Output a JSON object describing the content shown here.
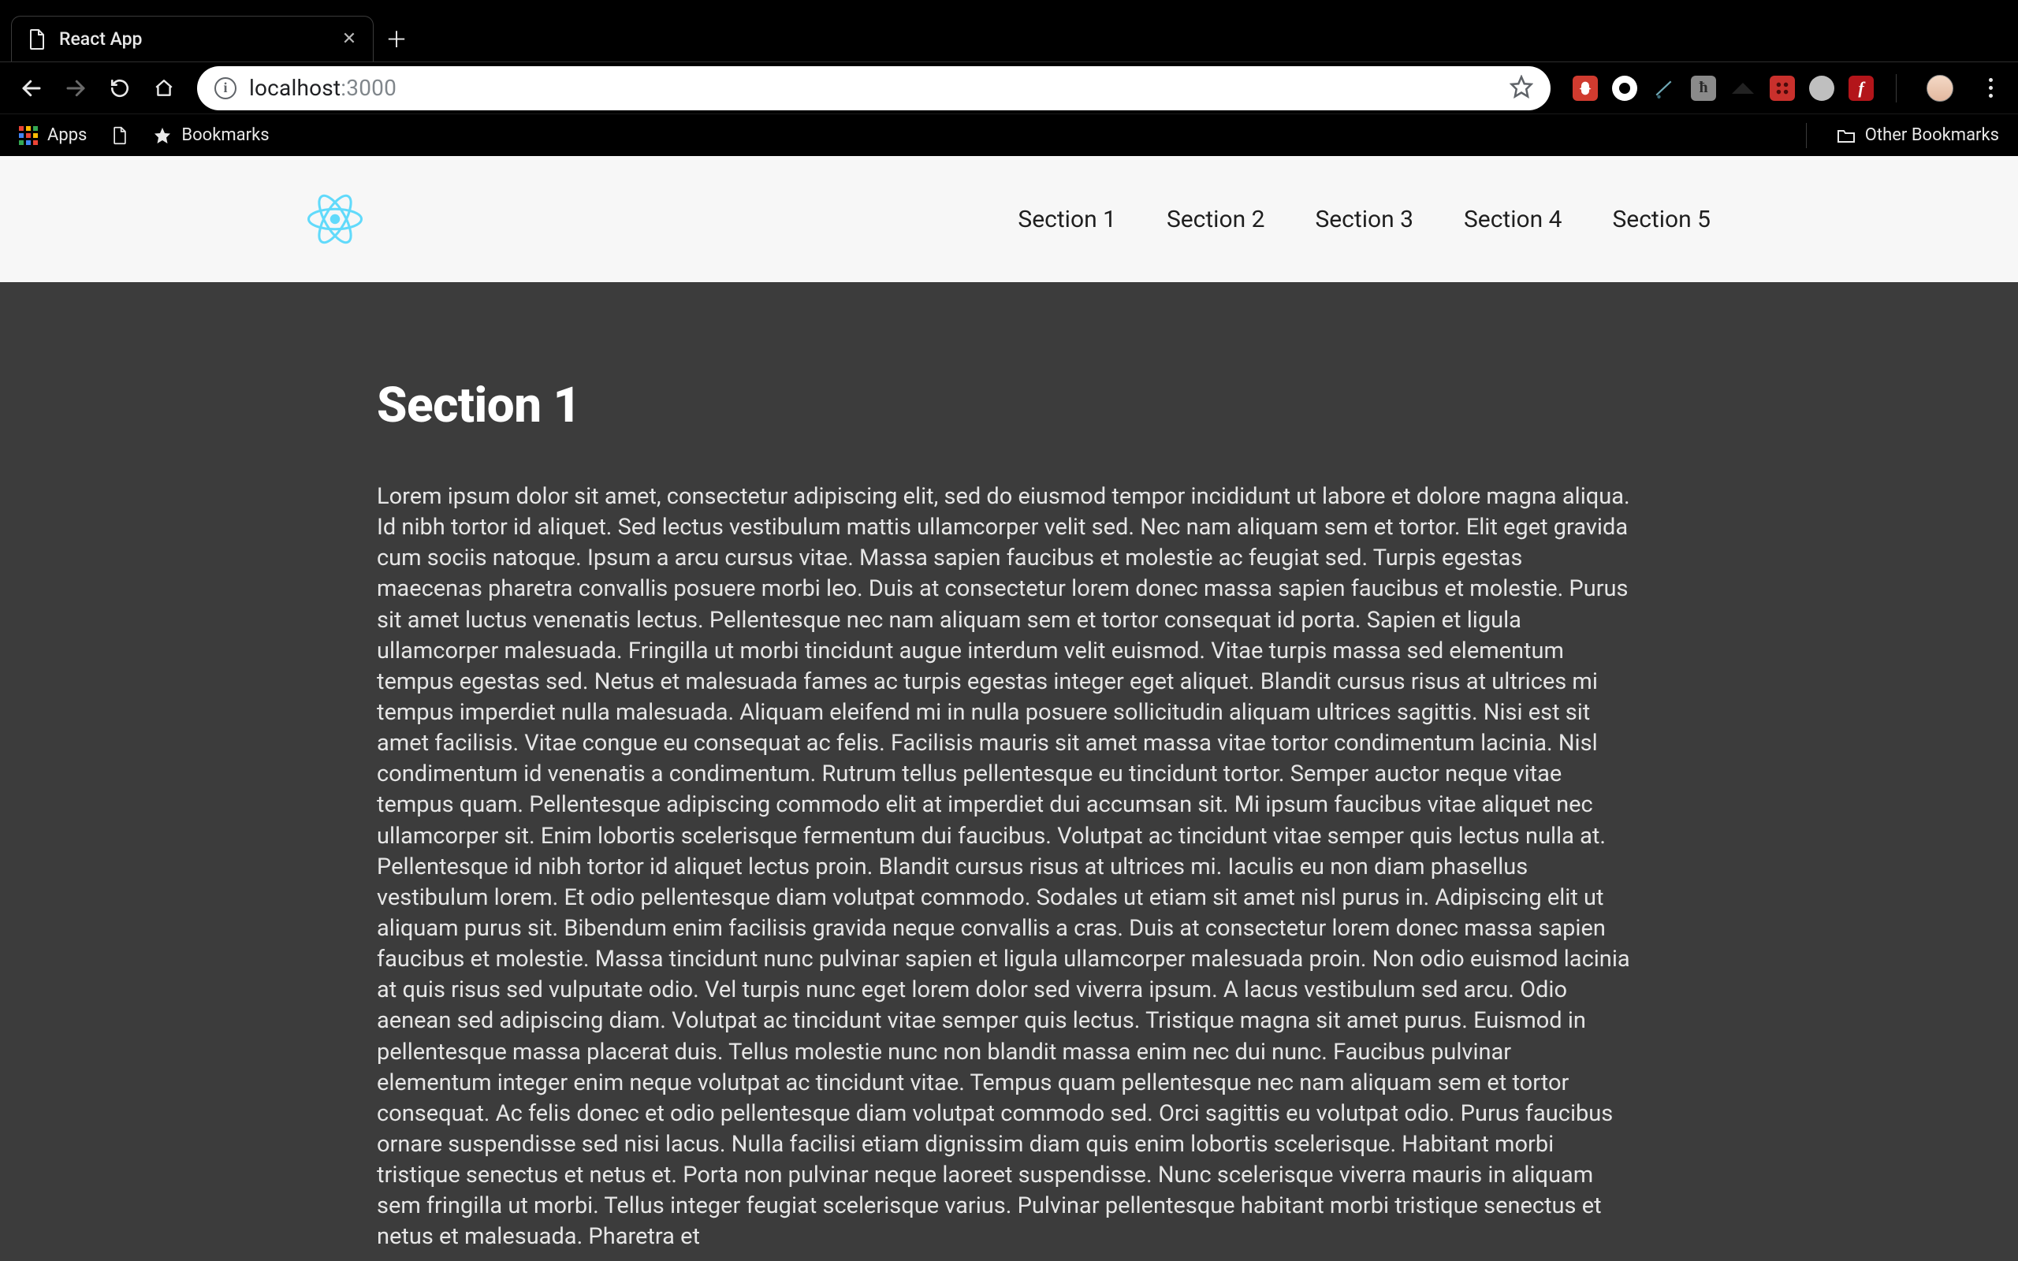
{
  "browser": {
    "tab_title": "React App",
    "url_host": "localhost",
    "url_port": ":3000",
    "bookmarks_bar": {
      "apps": "Apps",
      "bookmarks": "Bookmarks",
      "other": "Other Bookmarks"
    }
  },
  "page": {
    "nav": [
      "Section 1",
      "Section 2",
      "Section 3",
      "Section 4",
      "Section 5"
    ],
    "heading": "Section 1",
    "body": "Lorem ipsum dolor sit amet, consectetur adipiscing elit, sed do eiusmod tempor incididunt ut labore et dolore magna aliqua. Id nibh tortor id aliquet. Sed lectus vestibulum mattis ullamcorper velit sed. Nec nam aliquam sem et tortor. Elit eget gravida cum sociis natoque. Ipsum a arcu cursus vitae. Massa sapien faucibus et molestie ac feugiat sed. Turpis egestas maecenas pharetra convallis posuere morbi leo. Duis at consectetur lorem donec massa sapien faucibus et molestie. Purus sit amet luctus venenatis lectus. Pellentesque nec nam aliquam sem et tortor consequat id porta. Sapien et ligula ullamcorper malesuada. Fringilla ut morbi tincidunt augue interdum velit euismod. Vitae turpis massa sed elementum tempus egestas sed. Netus et malesuada fames ac turpis egestas integer eget aliquet. Blandit cursus risus at ultrices mi tempus imperdiet nulla malesuada. Aliquam eleifend mi in nulla posuere sollicitudin aliquam ultrices sagittis. Nisi est sit amet facilisis. Vitae congue eu consequat ac felis. Facilisis mauris sit amet massa vitae tortor condimentum lacinia. Nisl condimentum id venenatis a condimentum. Rutrum tellus pellentesque eu tincidunt tortor. Semper auctor neque vitae tempus quam. Pellentesque adipiscing commodo elit at imperdiet dui accumsan sit. Mi ipsum faucibus vitae aliquet nec ullamcorper sit. Enim lobortis scelerisque fermentum dui faucibus. Volutpat ac tincidunt vitae semper quis lectus nulla at. Pellentesque id nibh tortor id aliquet lectus proin. Blandit cursus risus at ultrices mi. Iaculis eu non diam phasellus vestibulum lorem. Et odio pellentesque diam volutpat commodo. Sodales ut etiam sit amet nisl purus in. Adipiscing elit ut aliquam purus sit. Bibendum enim facilisis gravida neque convallis a cras. Duis at consectetur lorem donec massa sapien faucibus et molestie. Massa tincidunt nunc pulvinar sapien et ligula ullamcorper malesuada proin. Non odio euismod lacinia at quis risus sed vulputate odio. Vel turpis nunc eget lorem dolor sed viverra ipsum. A lacus vestibulum sed arcu. Odio aenean sed adipiscing diam. Volutpat ac tincidunt vitae semper quis lectus. Tristique magna sit amet purus. Euismod in pellentesque massa placerat duis. Tellus molestie nunc non blandit massa enim nec dui nunc. Faucibus pulvinar elementum integer enim neque volutpat ac tincidunt vitae. Tempus quam pellentesque nec nam aliquam sem et tortor consequat. Ac felis donec et odio pellentesque diam volutpat commodo sed. Orci sagittis eu volutpat odio. Purus faucibus ornare suspendisse sed nisi lacus. Nulla facilisi etiam dignissim diam quis enim lobortis scelerisque. Habitant morbi tristique senectus et netus et. Porta non pulvinar neque laoreet suspendisse. Nunc scelerisque viverra mauris in aliquam sem fringilla ut morbi. Tellus integer feugiat scelerisque varius. Pulvinar pellentesque habitant morbi tristique senectus et netus et malesuada. Pharetra et"
  }
}
